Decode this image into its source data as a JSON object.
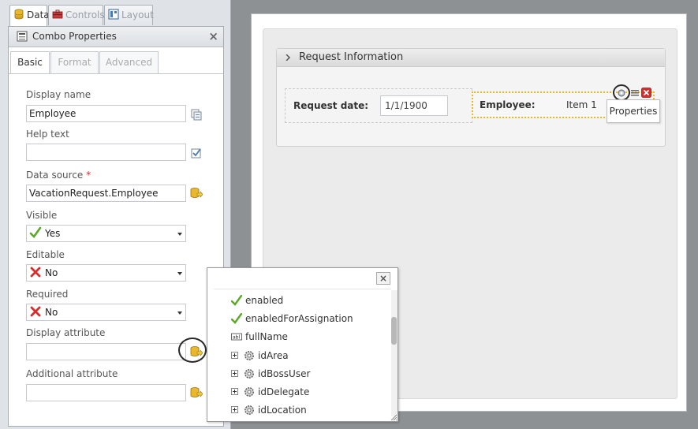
{
  "top_tabs": [
    {
      "label": "Data",
      "active": true
    },
    {
      "label": "Controls",
      "active": false
    },
    {
      "label": "Layout",
      "active": false
    }
  ],
  "panel": {
    "title": "Combo Properties",
    "close_glyph": "×",
    "sub_tabs": [
      {
        "label": "Basic",
        "active": true
      },
      {
        "label": "Format",
        "active": false
      },
      {
        "label": "Advanced",
        "active": false
      }
    ]
  },
  "fields": {
    "display_name": {
      "label": "Display name",
      "value": "Employee"
    },
    "help_text": {
      "label": "Help text",
      "value": ""
    },
    "data_source": {
      "label": "Data source",
      "required_mark": "*",
      "value": "VacationRequest.Employee"
    },
    "visible": {
      "label": "Visible",
      "value": "Yes",
      "icon": "check-icon"
    },
    "editable": {
      "label": "Editable",
      "value": "No",
      "icon": "x-icon"
    },
    "required": {
      "label": "Required",
      "value": "No",
      "icon": "x-icon"
    },
    "display_attribute": {
      "label": "Display attribute",
      "value": ""
    },
    "additional_attribute": {
      "label": "Additional attribute",
      "value": ""
    }
  },
  "form": {
    "group_title": "Request Information",
    "request_date_label": "Request date:",
    "request_date_value": "1/1/1900",
    "employee_label": "Employee:",
    "employee_value": "Item 1",
    "tooltip": "Properties"
  },
  "popup": {
    "close_glyph": "×",
    "items": [
      {
        "label": "enabled",
        "icon": "check-icon",
        "expandable": false
      },
      {
        "label": "enabledForAssignation",
        "icon": "check-icon",
        "expandable": false
      },
      {
        "label": "fullName",
        "icon": "text-field-icon",
        "expandable": false
      },
      {
        "label": "idArea",
        "icon": "gear-icon",
        "expandable": true
      },
      {
        "label": "idBossUser",
        "icon": "gear-icon",
        "expandable": true
      },
      {
        "label": "idDelegate",
        "icon": "gear-icon",
        "expandable": true
      },
      {
        "label": "idLocation",
        "icon": "gear-icon",
        "expandable": true
      }
    ]
  },
  "colors": {
    "accent_orange": "#f0b623",
    "check_green": "#5aa827",
    "x_red": "#d62d2d",
    "required_red": "#d02a2a"
  }
}
